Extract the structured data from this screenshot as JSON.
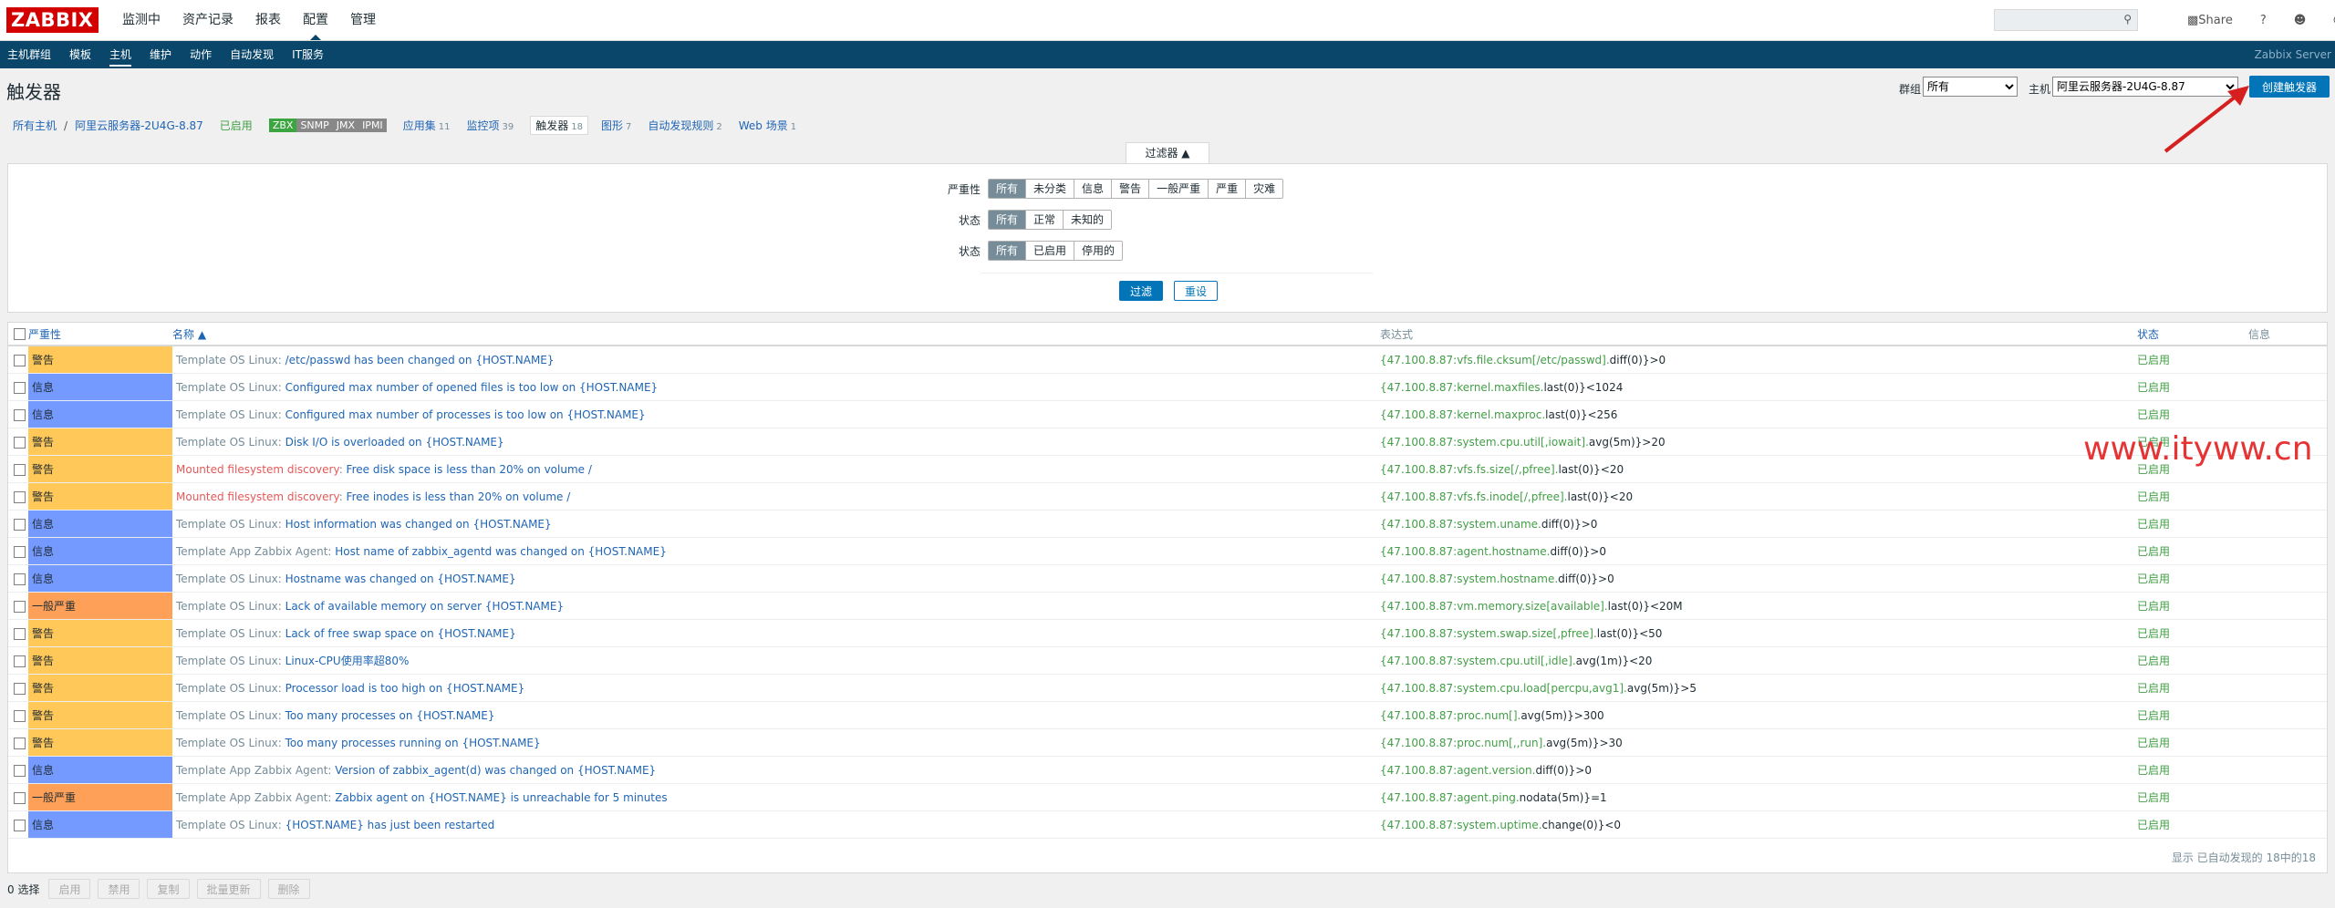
{
  "logo": "ZABBIX",
  "main_nav": [
    "监测中",
    "资产记录",
    "报表",
    "配置",
    "管理"
  ],
  "main_nav_active": 3,
  "top_tools": {
    "share": "Share",
    "help": "?",
    "user_icon": "user-icon",
    "power_icon": "power-icon"
  },
  "sub_nav": [
    "主机群组",
    "模板",
    "主机",
    "维护",
    "动作",
    "自动发现",
    "IT服务"
  ],
  "sub_nav_active": 2,
  "server_name": "Zabbix Server",
  "page_title": "触发器",
  "group_label": "群组",
  "group_value": "所有",
  "host_label": "主机",
  "host_value": "阿里云服务器-2U4G-8.87",
  "create_button": "创建触发器",
  "breadcrumb": {
    "all_hosts": "所有主机",
    "sep": "/",
    "host": "阿里云服务器-2U4G-8.87",
    "enabled": "已启用",
    "availability": [
      "ZBX",
      "SNMP",
      "JMX",
      "IPMI"
    ],
    "apps": {
      "label": "应用集",
      "count": "11"
    },
    "items": {
      "label": "监控项",
      "count": "39"
    },
    "triggers": {
      "label": "触发器",
      "count": "18"
    },
    "graphs": {
      "label": "图形",
      "count": "7"
    },
    "discovery": {
      "label": "自动发现规则",
      "count": "2"
    },
    "web": {
      "label": "Web 场景",
      "count": "1"
    }
  },
  "filter": {
    "tab": "过滤器 ▲",
    "severity_label": "严重性",
    "severity_options": [
      "所有",
      "未分类",
      "信息",
      "警告",
      "一般严重",
      "严重",
      "灾难"
    ],
    "state_label": "状态",
    "state_options": [
      "所有",
      "正常",
      "未知的"
    ],
    "status_label": "状态",
    "status_options": [
      "所有",
      "已启用",
      "停用的"
    ],
    "filter_button": "过滤",
    "reset_button": "重设"
  },
  "table": {
    "headers": {
      "severity": "严重性",
      "name": "名称 ▲",
      "expression": "表达式",
      "status": "状态",
      "info": "信息"
    },
    "rows": [
      {
        "severity": "警告",
        "sev_class": "warn",
        "template": "Template OS Linux",
        "tcls": "tmpl",
        "name": "/etc/passwd has been changed on {HOST.NAME}",
        "expr_item": "{47.100.8.87:vfs.file.cksum[/etc/passwd].",
        "expr_fn": "diff(0)",
        "expr_rest": "}>0",
        "status": "已启用"
      },
      {
        "severity": "信息",
        "sev_class": "info",
        "template": "Template OS Linux",
        "tcls": "tmpl",
        "name": "Configured max number of opened files is too low on {HOST.NAME}",
        "expr_item": "{47.100.8.87:kernel.maxfiles.",
        "expr_fn": "last(0)",
        "expr_rest": "}<1024",
        "status": "已启用"
      },
      {
        "severity": "信息",
        "sev_class": "info",
        "template": "Template OS Linux",
        "tcls": "tmpl",
        "name": "Configured max number of processes is too low on {HOST.NAME}",
        "expr_item": "{47.100.8.87:kernel.maxproc.",
        "expr_fn": "last(0)",
        "expr_rest": "}<256",
        "status": "已启用"
      },
      {
        "severity": "警告",
        "sev_class": "warn",
        "template": "Template OS Linux",
        "tcls": "tmpl",
        "name": "Disk I/O is overloaded on {HOST.NAME}",
        "expr_item": "{47.100.8.87:system.cpu.util[,iowait].",
        "expr_fn": "avg(5m)",
        "expr_rest": "}>20",
        "status": "已启用"
      },
      {
        "severity": "警告",
        "sev_class": "warn",
        "template": "Mounted filesystem discovery",
        "tcls": "tmpl-lld",
        "name": "Free disk space is less than 20% on volume /",
        "expr_item": "{47.100.8.87:vfs.fs.size[/,pfree].",
        "expr_fn": "last(0)",
        "expr_rest": "}<20",
        "status": "已启用"
      },
      {
        "severity": "警告",
        "sev_class": "warn",
        "template": "Mounted filesystem discovery",
        "tcls": "tmpl-lld",
        "name": "Free inodes is less than 20% on volume /",
        "expr_item": "{47.100.8.87:vfs.fs.inode[/,pfree].",
        "expr_fn": "last(0)",
        "expr_rest": "}<20",
        "status": "已启用"
      },
      {
        "severity": "信息",
        "sev_class": "info",
        "template": "Template OS Linux",
        "tcls": "tmpl",
        "name": "Host information was changed on {HOST.NAME}",
        "expr_item": "{47.100.8.87:system.uname.",
        "expr_fn": "diff(0)",
        "expr_rest": "}>0",
        "status": "已启用"
      },
      {
        "severity": "信息",
        "sev_class": "info",
        "template": "Template App Zabbix Agent",
        "tcls": "tmpl",
        "name": "Host name of zabbix_agentd was changed on {HOST.NAME}",
        "expr_item": "{47.100.8.87:agent.hostname.",
        "expr_fn": "diff(0)",
        "expr_rest": "}>0",
        "status": "已启用"
      },
      {
        "severity": "信息",
        "sev_class": "info",
        "template": "Template OS Linux",
        "tcls": "tmpl",
        "name": "Hostname was changed on {HOST.NAME}",
        "expr_item": "{47.100.8.87:system.hostname.",
        "expr_fn": "diff(0)",
        "expr_rest": "}>0",
        "status": "已启用"
      },
      {
        "severity": "一般严重",
        "sev_class": "avg",
        "template": "Template OS Linux",
        "tcls": "tmpl",
        "name": "Lack of available memory on server {HOST.NAME}",
        "expr_item": "{47.100.8.87:vm.memory.size[available].",
        "expr_fn": "last(0)",
        "expr_rest": "}<20M",
        "status": "已启用"
      },
      {
        "severity": "警告",
        "sev_class": "warn",
        "template": "Template OS Linux",
        "tcls": "tmpl",
        "name": "Lack of free swap space on {HOST.NAME}",
        "expr_item": "{47.100.8.87:system.swap.size[,pfree].",
        "expr_fn": "last(0)",
        "expr_rest": "}<50",
        "status": "已启用"
      },
      {
        "severity": "警告",
        "sev_class": "warn",
        "template": "Template OS Linux",
        "tcls": "tmpl",
        "name": "Linux-CPU使用率超80%",
        "expr_item": "{47.100.8.87:system.cpu.util[,idle].",
        "expr_fn": "avg(1m)",
        "expr_rest": "}<20",
        "status": "已启用"
      },
      {
        "severity": "警告",
        "sev_class": "warn",
        "template": "Template OS Linux",
        "tcls": "tmpl",
        "name": "Processor load is too high on {HOST.NAME}",
        "expr_item": "{47.100.8.87:system.cpu.load[percpu,avg1].",
        "expr_fn": "avg(5m)",
        "expr_rest": "}>5",
        "status": "已启用"
      },
      {
        "severity": "警告",
        "sev_class": "warn",
        "template": "Template OS Linux",
        "tcls": "tmpl",
        "name": "Too many processes on {HOST.NAME}",
        "expr_item": "{47.100.8.87:proc.num[].",
        "expr_fn": "avg(5m)",
        "expr_rest": "}>300",
        "status": "已启用"
      },
      {
        "severity": "警告",
        "sev_class": "warn",
        "template": "Template OS Linux",
        "tcls": "tmpl",
        "name": "Too many processes running on {HOST.NAME}",
        "expr_item": "{47.100.8.87:proc.num[,,run].",
        "expr_fn": "avg(5m)",
        "expr_rest": "}>30",
        "status": "已启用"
      },
      {
        "severity": "信息",
        "sev_class": "info",
        "template": "Template App Zabbix Agent",
        "tcls": "tmpl",
        "name": "Version of zabbix_agent(d) was changed on {HOST.NAME}",
        "expr_item": "{47.100.8.87:agent.version.",
        "expr_fn": "diff(0)",
        "expr_rest": "}>0",
        "status": "已启用"
      },
      {
        "severity": "一般严重",
        "sev_class": "avg",
        "template": "Template App Zabbix Agent",
        "tcls": "tmpl",
        "name": "Zabbix agent on {HOST.NAME} is unreachable for 5 minutes",
        "expr_item": "{47.100.8.87:agent.ping.",
        "expr_fn": "nodata(5m)",
        "expr_rest": "}=1",
        "status": "已启用"
      },
      {
        "severity": "信息",
        "sev_class": "info",
        "template": "Template OS Linux",
        "tcls": "tmpl",
        "name": "{HOST.NAME} has just been restarted",
        "expr_item": "{47.100.8.87:system.uptime.",
        "expr_fn": "change(0)",
        "expr_rest": "}<0",
        "status": "已启用"
      }
    ],
    "footer": "显示 已自动发现的 18中的18"
  },
  "bottom": {
    "selected": "0 选择",
    "buttons": [
      "启用",
      "禁用",
      "复制",
      "批量更新",
      "删除"
    ]
  },
  "watermark": "www.ityww.cn",
  "colors": {
    "warn": "#ffc859",
    "info": "#7499ff",
    "average": "#ffa059",
    "accent": "#0275b8",
    "nav": "#0a466a"
  }
}
